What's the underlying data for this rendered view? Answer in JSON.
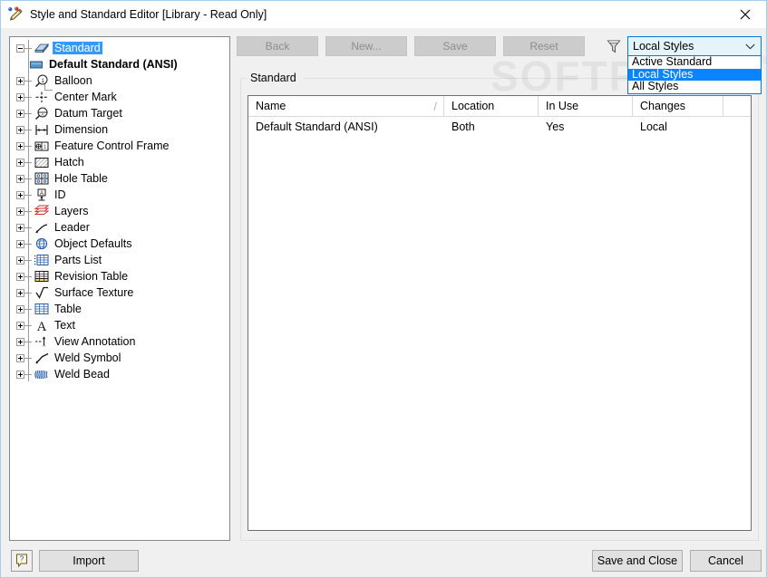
{
  "window": {
    "title": "Style and Standard Editor [Library - Read Only]",
    "icon": "style-editor-icon",
    "close_label": "✕"
  },
  "watermark": {
    "text": "SOFTPEDIA",
    "registered": "®"
  },
  "tree": {
    "root": {
      "label": "Standard",
      "icon": "standard-book-icon",
      "selected": true,
      "expanded": true
    },
    "child": {
      "label": "Default Standard (ANSI)",
      "icon": "standard-swatch-icon"
    },
    "items": [
      {
        "label": "Balloon",
        "icon": "balloon-icon"
      },
      {
        "label": "Center Mark",
        "icon": "center-mark-icon"
      },
      {
        "label": "Datum Target",
        "icon": "datum-target-icon"
      },
      {
        "label": "Dimension",
        "icon": "dimension-icon"
      },
      {
        "label": "Feature Control Frame",
        "icon": "feature-control-frame-icon"
      },
      {
        "label": "Hatch",
        "icon": "hatch-icon"
      },
      {
        "label": "Hole Table",
        "icon": "hole-table-icon"
      },
      {
        "label": "ID",
        "icon": "id-icon"
      },
      {
        "label": "Layers",
        "icon": "layers-icon"
      },
      {
        "label": "Leader",
        "icon": "leader-icon"
      },
      {
        "label": "Object Defaults",
        "icon": "object-defaults-icon"
      },
      {
        "label": "Parts List",
        "icon": "parts-list-icon"
      },
      {
        "label": "Revision Table",
        "icon": "revision-table-icon"
      },
      {
        "label": "Surface Texture",
        "icon": "surface-texture-icon"
      },
      {
        "label": "Table",
        "icon": "table-icon"
      },
      {
        "label": "Text",
        "icon": "text-icon"
      },
      {
        "label": "View Annotation",
        "icon": "view-annotation-icon"
      },
      {
        "label": "Weld Symbol",
        "icon": "weld-symbol-icon"
      },
      {
        "label": "Weld Bead",
        "icon": "weld-bead-icon"
      }
    ]
  },
  "toolbar": {
    "back_label": "Back",
    "new_label": "New...",
    "save_label": "Save",
    "reset_label": "Reset",
    "filter_icon": "funnel-filter-icon"
  },
  "filter_combo": {
    "value": "Local Styles",
    "expanded": true,
    "options": [
      {
        "label": "Active Standard",
        "selected": false
      },
      {
        "label": "Local Styles",
        "selected": true
      },
      {
        "label": "All Styles",
        "selected": false
      }
    ]
  },
  "group": {
    "title": "Standard"
  },
  "table": {
    "columns": [
      "Name",
      "Location",
      "In Use",
      "Changes",
      ""
    ],
    "sort_indicator": "/",
    "rows": [
      {
        "name": "Default Standard (ANSI)",
        "location": "Both",
        "in_use": "Yes",
        "changes": "Local",
        "extra": ""
      }
    ]
  },
  "footer": {
    "help_label": "?",
    "import_label": "Import",
    "save_and_close_label": "Save and Close",
    "cancel_label": "Cancel"
  },
  "colors": {
    "accent": "#0078d7",
    "selection": "#3399ff",
    "list_selection": "#0a84ff",
    "window_bg": "#f0f0f0",
    "combo_bg": "#e5f3fb",
    "disabled_btn": "#cccccc",
    "disabled_text": "#8d8d8d"
  }
}
